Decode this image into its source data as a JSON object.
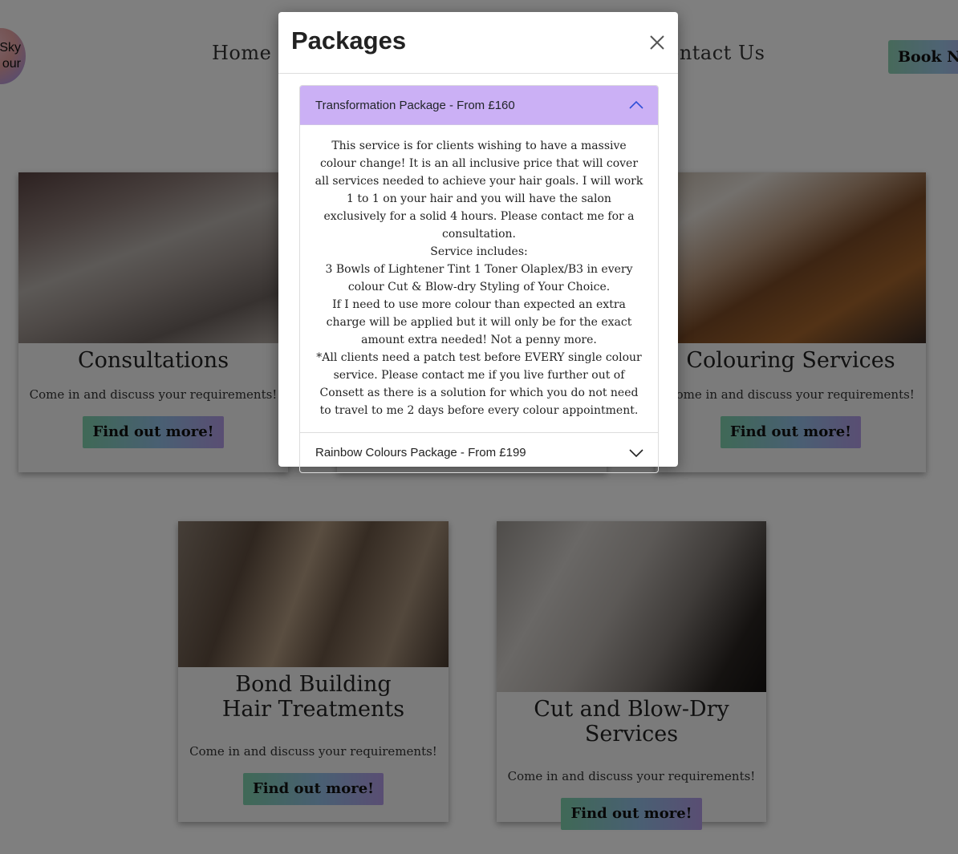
{
  "header": {
    "logo_lines": [
      "Sky",
      "our"
    ],
    "nav": [
      "Home",
      "Contact Us"
    ],
    "book_label": "Book Now"
  },
  "cards": [
    {
      "title": "Consultations",
      "text": "Come in and discuss your requirements!",
      "button": "Find out more!"
    },
    {
      "title": "Colouring Services",
      "text": "Come in and discuss your requirements!",
      "button": "Find out more!"
    },
    {
      "title": "Bond Building Hair Treatments",
      "text": "Come in and discuss your requirements!",
      "button": "Find out more!"
    },
    {
      "title": "Cut and Blow-Dry Services",
      "text": "Come in and discuss your requirements!",
      "button": "Find out more!"
    }
  ],
  "modal": {
    "title": "Packages",
    "accordion": [
      {
        "label": "Transformation Package - From £160",
        "expanded": true,
        "body": [
          "This service is for clients wishing to have a massive colour change! It is an all inclusive price that will cover all services needed to achieve your hair goals. I will work 1 to 1 on your hair and you will have the salon exclusively for a solid 4 hours. Please contact me for a consultation.",
          "Service includes:",
          "3 Bowls of Lightener Tint 1 Toner Olaplex/B3 in every colour Cut & Blow-dry Styling of Your Choice.",
          "If I need to use more colour than expected an extra charge will be applied but it will only be for the exact amount extra needed! Not a penny more.",
          "*All clients need a patch test before EVERY single colour service. Please contact me if you live further out of Consett as there is a solution for which you do not need to travel to me 2 days before every colour appointment."
        ]
      },
      {
        "label": "Rainbow Colours Package - From £199",
        "expanded": false
      }
    ]
  },
  "colors": {
    "accordion_active_bg": "#cbb0f5",
    "overlay": "rgba(0,0,0,0.5)",
    "button_gradient": [
      "#7fd2ad",
      "#93bfe6",
      "#b39ce6"
    ]
  }
}
